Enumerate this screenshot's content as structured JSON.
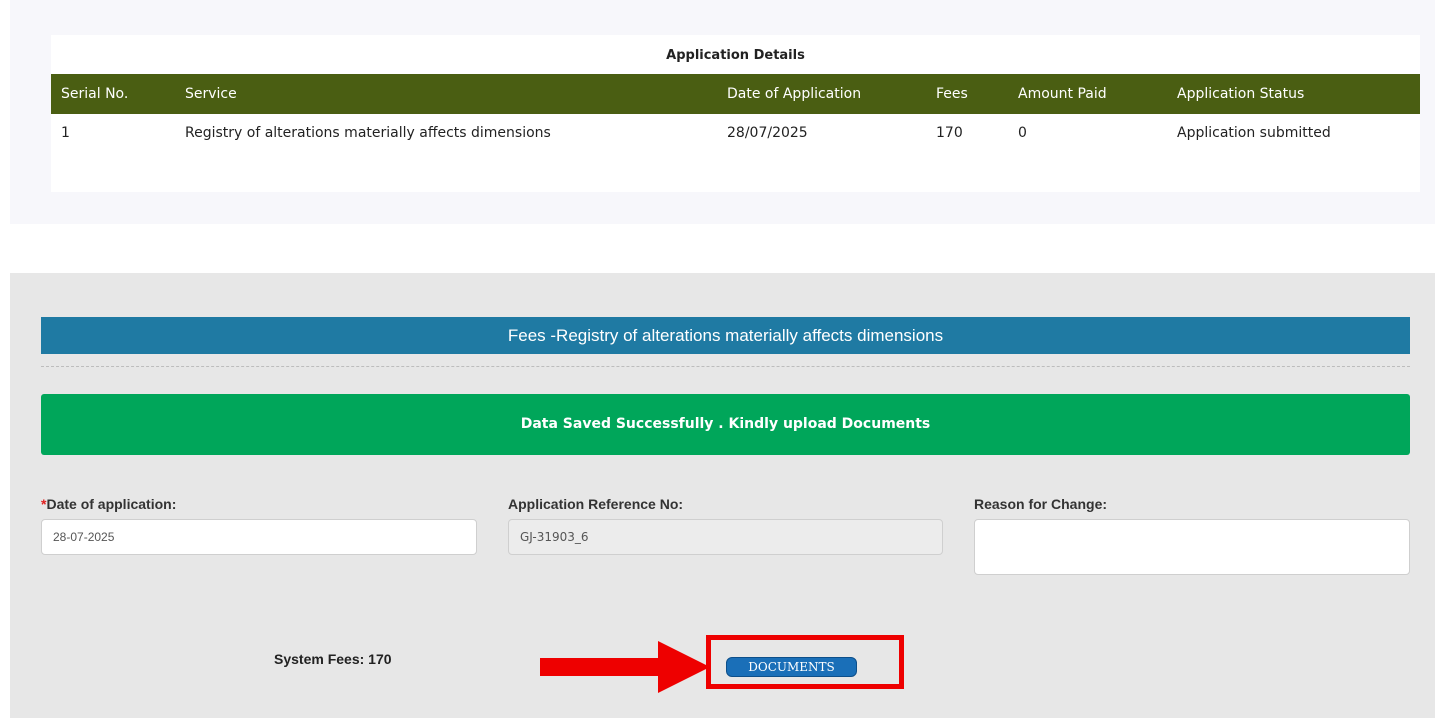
{
  "application_details": {
    "title": "Application Details",
    "columns": [
      "Serial No.",
      "Service",
      "Date of Application",
      "Fees",
      "Amount Paid",
      "Application Status"
    ],
    "rows": [
      [
        "1",
        "Registry of alterations materially affects dimensions",
        "28/07/2025",
        "170",
        "0",
        "Application submitted"
      ]
    ]
  },
  "fees_section": {
    "header": "Fees -Registry of alterations materially affects dimensions",
    "success_message": "Data Saved Successfully . Kindly upload Documents",
    "date_of_application": {
      "required_mark": "*",
      "label": "Date of application:",
      "value": "28-07-2025"
    },
    "reference_no": {
      "label": "Application Reference No:",
      "value": "GJ-31903_6"
    },
    "reason_for_change": {
      "label": "Reason for Change:",
      "value": ""
    },
    "system_fees_label": "System Fees:",
    "system_fees_value": "170",
    "documents_button": "DOCUMENTS"
  },
  "colors": {
    "table_header": "#4a5e12",
    "fees_header": "#1f7aa3",
    "success": "#00a65a",
    "documents_button": "#1a6fb8",
    "highlight": "#ee0000"
  }
}
